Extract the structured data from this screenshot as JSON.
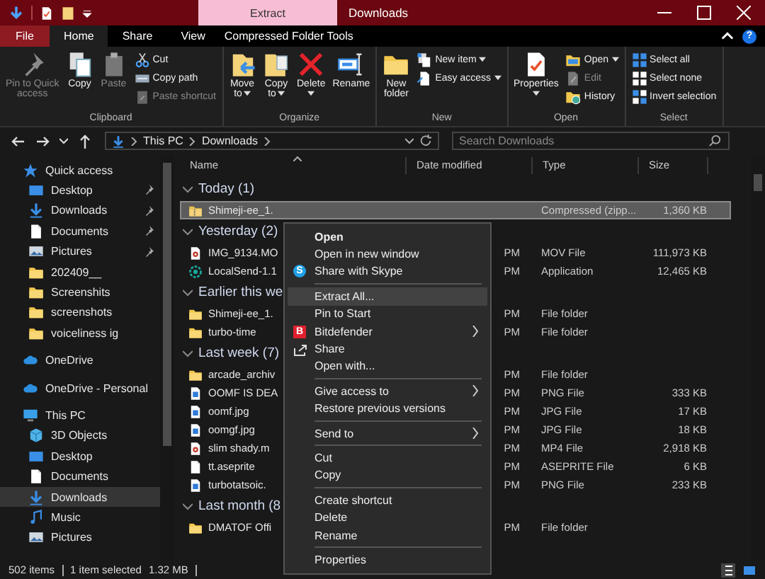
{
  "window": {
    "title": "Downloads",
    "context_tab": "Extract"
  },
  "ribbon_tabs": [
    {
      "label": "File",
      "kind": "file",
      "selected": false
    },
    {
      "label": "Home",
      "kind": "tab",
      "selected": true
    },
    {
      "label": "Share",
      "kind": "tab",
      "selected": false
    },
    {
      "label": "View",
      "kind": "tab",
      "selected": false
    },
    {
      "label": "Compressed Folder Tools",
      "kind": "tab",
      "selected": false
    }
  ],
  "help": "?",
  "ribbon": {
    "groups": [
      {
        "label": "Clipboard",
        "commands": [
          {
            "label": "Pin to Quick\naccess",
            "kind": "large",
            "disabled": true,
            "dropdown": false
          },
          {
            "label": "Copy",
            "kind": "large",
            "disabled": false,
            "dropdown": false
          },
          {
            "label": "Paste",
            "kind": "large",
            "disabled": true,
            "dropdown": false
          },
          {
            "label": "Cut",
            "kind": "small",
            "disabled": false,
            "dropdown": false
          },
          {
            "label": "Copy path",
            "kind": "small",
            "disabled": false,
            "dropdown": false
          },
          {
            "label": "Paste shortcut",
            "kind": "small",
            "disabled": true,
            "dropdown": false
          }
        ]
      },
      {
        "label": "Organize",
        "commands": [
          {
            "label": "Move\nto",
            "kind": "large",
            "disabled": false,
            "dropdown": true
          },
          {
            "label": "Copy\nto",
            "kind": "large",
            "disabled": false,
            "dropdown": true
          },
          {
            "label": "Delete",
            "kind": "large",
            "disabled": false,
            "dropdown": true
          },
          {
            "label": "Rename",
            "kind": "large",
            "disabled": false,
            "dropdown": false
          }
        ]
      },
      {
        "label": "New",
        "commands": [
          {
            "label": "New\nfolder",
            "kind": "large",
            "disabled": false,
            "dropdown": false
          },
          {
            "label": "New item",
            "kind": "small",
            "disabled": false,
            "dropdown": true
          },
          {
            "label": "Easy access",
            "kind": "small",
            "disabled": false,
            "dropdown": true
          }
        ]
      },
      {
        "label": "Open",
        "commands": [
          {
            "label": "Properties",
            "kind": "large",
            "disabled": false,
            "dropdown": true
          },
          {
            "label": "Open",
            "kind": "small",
            "disabled": false,
            "dropdown": true
          },
          {
            "label": "Edit",
            "kind": "small",
            "disabled": true,
            "dropdown": false
          },
          {
            "label": "History",
            "kind": "small",
            "disabled": false,
            "dropdown": false
          }
        ]
      },
      {
        "label": "Select",
        "commands": [
          {
            "label": "Select all",
            "kind": "small",
            "disabled": false,
            "dropdown": false
          },
          {
            "label": "Select none",
            "kind": "small",
            "disabled": false,
            "dropdown": false
          },
          {
            "label": "Invert selection",
            "kind": "small",
            "disabled": false,
            "dropdown": false
          }
        ]
      }
    ]
  },
  "address": {
    "crumbs": [
      "This PC",
      "Downloads"
    ]
  },
  "search": {
    "placeholder": "Search Downloads"
  },
  "sidebar": {
    "items": [
      {
        "label": "Quick access",
        "kind": "star",
        "selected": false,
        "children": [
          {
            "label": "Desktop",
            "kind": "desktop",
            "selected": false,
            "pinned": true
          },
          {
            "label": "Downloads",
            "kind": "download",
            "selected": false,
            "pinned": true
          },
          {
            "label": "Documents",
            "kind": "document",
            "selected": false,
            "pinned": true
          },
          {
            "label": "Pictures",
            "kind": "picture",
            "selected": false,
            "pinned": true
          },
          {
            "label": "202409__",
            "kind": "folder",
            "selected": false,
            "pinned": false
          },
          {
            "label": "Screenshits",
            "kind": "folder",
            "selected": false,
            "pinned": false
          },
          {
            "label": "screenshots",
            "kind": "folder",
            "selected": false,
            "pinned": false
          },
          {
            "label": "voiceliness ig",
            "kind": "folder",
            "selected": false,
            "pinned": false
          }
        ]
      },
      {
        "label": "OneDrive",
        "kind": "cloud",
        "selected": false
      },
      {
        "label": "OneDrive - Personal",
        "kind": "cloud",
        "selected": false
      },
      {
        "label": "This PC",
        "kind": "pc",
        "selected": false,
        "children": [
          {
            "label": "3D Objects",
            "kind": "cube",
            "selected": false
          },
          {
            "label": "Desktop",
            "kind": "desktop",
            "selected": false
          },
          {
            "label": "Documents",
            "kind": "document",
            "selected": false
          },
          {
            "label": "Downloads",
            "kind": "download",
            "selected": true
          },
          {
            "label": "Music",
            "kind": "music",
            "selected": false
          },
          {
            "label": "Pictures",
            "kind": "picture",
            "selected": false
          }
        ]
      }
    ]
  },
  "columns": [
    "Name",
    "Date modified",
    "Type",
    "Size"
  ],
  "groups": [
    {
      "label": "Today (1)",
      "expanded": true,
      "rows": [
        {
          "name": "Shimeji-ee_1.",
          "type": "Compressed (zipp...",
          "size": "1,360 KB",
          "kind": "zip",
          "selected": true
        }
      ]
    },
    {
      "label": "Yesterday (2)",
      "expanded": true,
      "rows": [
        {
          "name": "IMG_9134.MO",
          "date": "PM",
          "type": "MOV File",
          "size": "111,973 KB",
          "kind": "video",
          "selected": false
        },
        {
          "name": "LocalSend-1.1",
          "date": "PM",
          "type": "Application",
          "size": "12,465 KB",
          "kind": "app",
          "selected": false
        }
      ]
    },
    {
      "label": "Earlier this we",
      "expanded": true,
      "rows": [
        {
          "name": "Shimeji-ee_1.",
          "date": "PM",
          "type": "File folder",
          "kind": "folder",
          "selected": false
        },
        {
          "name": "turbo-time",
          "date": "PM",
          "type": "File folder",
          "kind": "folder",
          "selected": false
        }
      ]
    },
    {
      "label": "Last week (7)",
      "expanded": true,
      "rows": [
        {
          "name": "arcade_archiv",
          "date": "PM",
          "type": "File folder",
          "kind": "folder",
          "selected": false
        },
        {
          "name": "OOMF IS DEA",
          "date": "PM",
          "type": "PNG File",
          "size": "333 KB",
          "kind": "image",
          "selected": false
        },
        {
          "name": "oomf.jpg",
          "date": "PM",
          "type": "JPG File",
          "size": "17 KB",
          "kind": "image",
          "selected": false
        },
        {
          "name": "oomgf.jpg",
          "date": "PM",
          "type": "JPG File",
          "size": "18 KB",
          "kind": "image",
          "selected": false
        },
        {
          "name": "slim shady.m",
          "date": "PM",
          "type": "MP4 File",
          "size": "2,918 KB",
          "kind": "video",
          "selected": false
        },
        {
          "name": "tt.aseprite",
          "date": "PM",
          "type": "ASEPRITE File",
          "size": "6 KB",
          "kind": "document",
          "selected": false
        },
        {
          "name": "turbotatsoic.",
          "date": "PM",
          "type": "PNG File",
          "size": "233 KB",
          "kind": "image",
          "selected": false
        }
      ]
    },
    {
      "label": "Last month (8",
      "expanded": true,
      "rows": [
        {
          "name": "DMATOF Offi",
          "date": "PM",
          "type": "File folder",
          "kind": "folder",
          "selected": false
        }
      ]
    }
  ],
  "context_menu": {
    "sections": [
      [
        {
          "label": "Open",
          "kind": "plain",
          "default": true,
          "highlighted": false,
          "submenu": false
        },
        {
          "label": "Open in new window",
          "kind": "plain",
          "default": false,
          "highlighted": false,
          "submenu": false
        },
        {
          "label": "Share with Skype",
          "kind": "skype",
          "badge": "S",
          "default": false,
          "highlighted": false,
          "submenu": false
        }
      ],
      [
        {
          "label": "Extract All...",
          "kind": "plain",
          "default": false,
          "highlighted": true,
          "submenu": false
        },
        {
          "label": "Pin to Start",
          "kind": "plain",
          "default": false,
          "highlighted": false,
          "submenu": false
        },
        {
          "label": "Bitdefender",
          "kind": "bitdefender",
          "badge": "B",
          "default": false,
          "highlighted": false,
          "submenu": true
        },
        {
          "label": "Share",
          "kind": "share",
          "default": false,
          "highlighted": false,
          "submenu": false
        },
        {
          "label": "Open with...",
          "kind": "plain",
          "default": false,
          "highlighted": false,
          "submenu": false
        }
      ],
      [
        {
          "label": "Give access to",
          "kind": "plain",
          "default": false,
          "highlighted": false,
          "submenu": true
        },
        {
          "label": "Restore previous versions",
          "kind": "plain",
          "default": false,
          "highlighted": false,
          "submenu": false
        }
      ],
      [
        {
          "label": "Send to",
          "kind": "plain",
          "default": false,
          "highlighted": false,
          "submenu": true
        }
      ],
      [
        {
          "label": "Cut",
          "kind": "plain",
          "default": false,
          "highlighted": false,
          "submenu": false
        },
        {
          "label": "Copy",
          "kind": "plain",
          "default": false,
          "highlighted": false,
          "submenu": false
        }
      ],
      [
        {
          "label": "Create shortcut",
          "kind": "plain",
          "default": false,
          "highlighted": false,
          "submenu": false
        },
        {
          "label": "Delete",
          "kind": "plain",
          "default": false,
          "highlighted": false,
          "submenu": false
        },
        {
          "label": "Rename",
          "kind": "plain",
          "default": false,
          "highlighted": false,
          "submenu": false
        }
      ],
      [
        {
          "label": "Properties",
          "kind": "plain",
          "default": false,
          "highlighted": false,
          "submenu": false
        }
      ]
    ]
  },
  "status_bar": {
    "item_count": "502 items",
    "selection": "1 item selected",
    "selection_size": "1.32 MB"
  }
}
